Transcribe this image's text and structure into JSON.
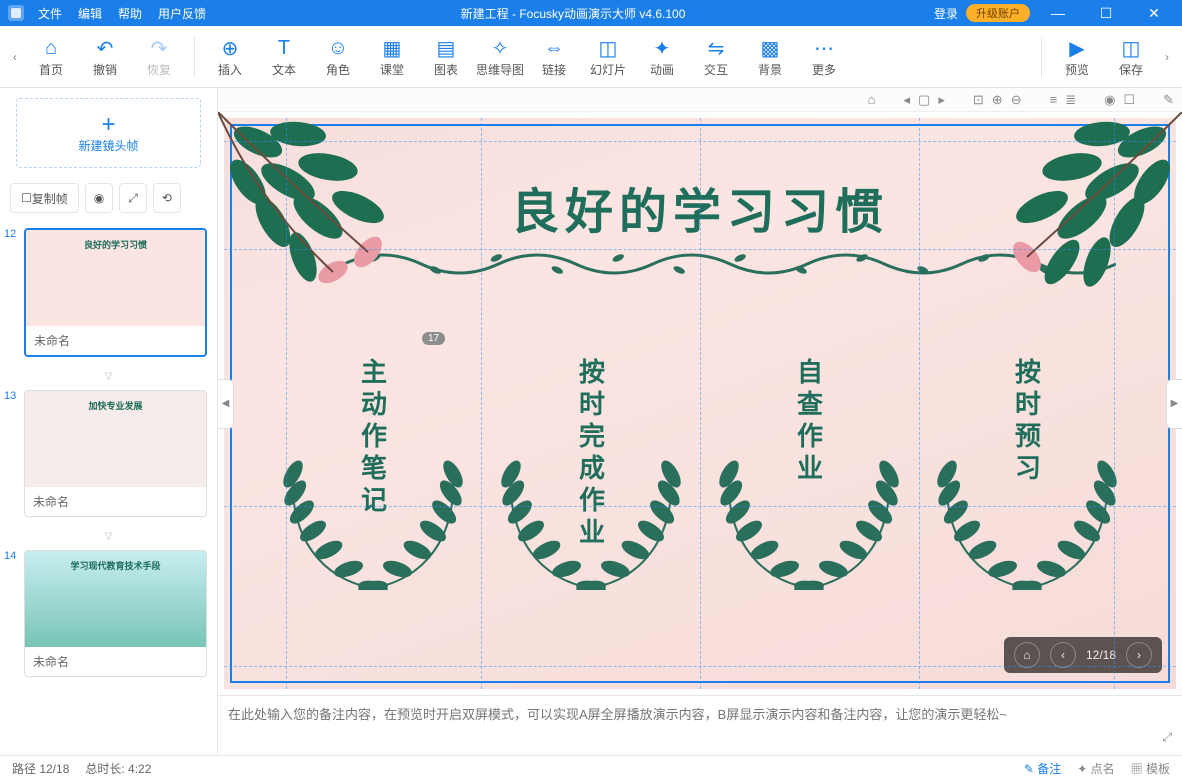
{
  "titlebar": {
    "menus": [
      "文件",
      "编辑",
      "帮助",
      "用户反馈"
    ],
    "title": "新建工程 - Focusky动画演示大师  v4.6.100",
    "login": "登录",
    "upgrade": "升级账户"
  },
  "ribbon": {
    "leftGroup": [
      {
        "icon": "⌂",
        "label": "首页"
      },
      {
        "icon": "↶",
        "label": "撤销"
      },
      {
        "icon": "↷",
        "label": "恢复",
        "disabled": true
      }
    ],
    "mainGroup": [
      {
        "icon": "⊕",
        "label": "插入"
      },
      {
        "icon": "T",
        "label": "文本"
      },
      {
        "icon": "☺",
        "label": "角色"
      },
      {
        "icon": "▦",
        "label": "课堂"
      },
      {
        "icon": "▤",
        "label": "图表"
      },
      {
        "icon": "✧",
        "label": "思维导图"
      },
      {
        "icon": "⇔",
        "label": "链接"
      },
      {
        "icon": "◫",
        "label": "幻灯片"
      },
      {
        "icon": "✦",
        "label": "动画"
      },
      {
        "icon": "⇋",
        "label": "交互"
      },
      {
        "icon": "▩",
        "label": "背景"
      },
      {
        "icon": "⋯",
        "label": "更多"
      }
    ],
    "rightGroup": [
      {
        "icon": "▶",
        "label": "预览"
      },
      {
        "icon": "◫",
        "label": "保存"
      }
    ]
  },
  "sidebar": {
    "newFrame": "新建镜头帧",
    "copyFrame": "复制帧",
    "thumbs": [
      {
        "num": "12",
        "label": "未命名",
        "selected": true,
        "cls": "th12",
        "title": "良好的学习习惯"
      },
      {
        "num": "13",
        "label": "未命名",
        "selected": false,
        "cls": "th13",
        "title": "加快专业发展"
      },
      {
        "num": "14",
        "label": "未命名",
        "selected": false,
        "cls": "th14",
        "title": "学习现代教育技术手段"
      }
    ]
  },
  "canvas": {
    "title": "良好的学习习惯",
    "badge": "17",
    "columns": [
      "主动作笔记",
      "按时完成作业",
      "自查作业",
      "按时预习"
    ],
    "nav": "12/18"
  },
  "notes": {
    "placeholder": "在此处输入您的备注内容，在预览时开启双屏模式，可以实现A屏全屏播放演示内容，B屏显示演示内容和备注内容，让您的演示更轻松~"
  },
  "statusbar": {
    "path": "路径 12/18",
    "total": "总时长: 4:22",
    "remark": "备注",
    "speaker": "点名",
    "tmpl": "模板"
  }
}
